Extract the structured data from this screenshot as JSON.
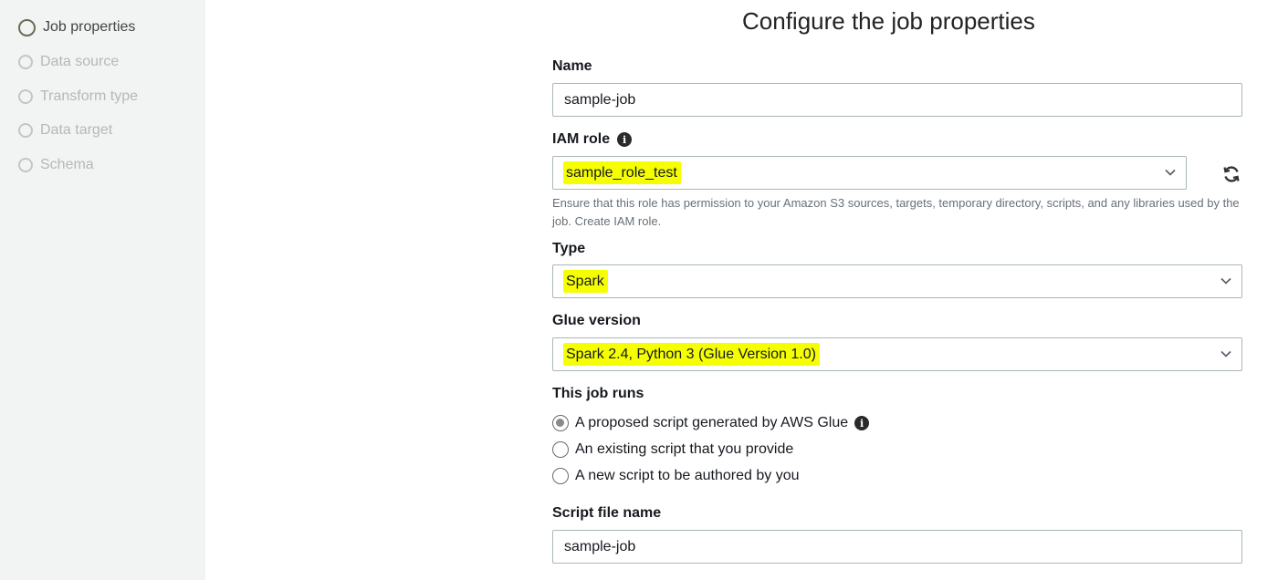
{
  "steps": [
    {
      "label": "Job properties",
      "active": true
    },
    {
      "label": "Data source",
      "active": false
    },
    {
      "label": "Transform type",
      "active": false
    },
    {
      "label": "Data target",
      "active": false
    },
    {
      "label": "Schema",
      "active": false
    }
  ],
  "page_title": "Configure the job properties",
  "name_field": {
    "label": "Name",
    "value": "sample-job"
  },
  "iam_role": {
    "label": "IAM role",
    "value": "sample_role_test",
    "hint": "Ensure that this role has permission to your Amazon S3 sources, targets, temporary directory, scripts, and any libraries used by the job. Create IAM role."
  },
  "type_field": {
    "label": "Type",
    "value": "Spark"
  },
  "glue_version": {
    "label": "Glue version",
    "value": "Spark 2.4, Python 3 (Glue Version 1.0)"
  },
  "job_runs": {
    "label": "This job runs",
    "options": [
      {
        "label": "A proposed script generated by AWS Glue",
        "checked": true
      },
      {
        "label": "An existing script that you provide",
        "checked": false
      },
      {
        "label": "A new script to be authored by you",
        "checked": false
      }
    ]
  },
  "script_file": {
    "label": "Script file name",
    "value": "sample-job"
  },
  "colors": {
    "highlight": "#f6ff00",
    "sidebar_bg": "#f2f3f3",
    "border": "#aab7b8"
  },
  "icons": [
    "info-icon",
    "refresh-icon",
    "chevron-down-icon",
    "step-circle-icon"
  ]
}
